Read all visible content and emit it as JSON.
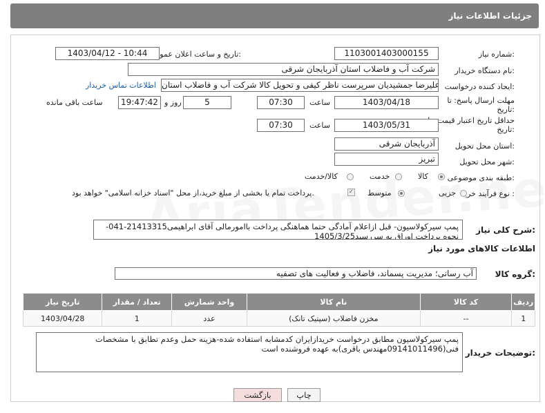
{
  "header": {
    "title": "جزئیات اطلاعات نیاز"
  },
  "fields": {
    "need_number_label": "شماره نیاز:",
    "need_number": "1103001403000155",
    "announce_label": "تاریخ و ساعت اعلان عمومی:",
    "announce_value": "1403/04/12 - 10:44",
    "buyer_org_label": "نام دستگاه خریدار:",
    "buyer_org": "شرکت آب و فاضلاب استان آذربایجان شرقی",
    "requester_label": "ایجاد کننده درخواست:",
    "requester": "علیرضا جمشیدیان سرپرست ناظر کیفی و تحویل کالا شرکت آب و فاضلاب استان",
    "buyer_contact_link": "اطلاعات تماس خریدار",
    "deadline_label_1": "مهلت ارسال پاسخ: تا",
    "deadline_label_2": "تاریخ:",
    "deadline_date": "1403/04/18",
    "time_label": "ساعت",
    "deadline_time": "07:30",
    "days_value": "5",
    "days_label": "روز و",
    "remaining_time": "19:47:42",
    "remaining_label": "ساعت باقی مانده",
    "min_validity_label_1": "حداقل تاریخ اعتبار قیمت: تا",
    "min_validity_label_2": "تاریخ:",
    "validity_date": "1403/05/31",
    "validity_time": "07:30",
    "province_label": "استان محل تحویل:",
    "province": "آذربایجان شرقی",
    "city_label": "شهر محل تحویل:",
    "city": "تبریز",
    "category_label": "طبقه بندی موضوعی:",
    "category_options": [
      "کالا",
      "خدمت",
      "کالا/خدمت"
    ],
    "process_label": "نوع فرآیند خرید :",
    "process_options": [
      "جزیی",
      "متوسط"
    ],
    "payment_note": "پرداخت تمام یا بخشی از مبلغ خرید،از محل \"اسناد خزانه اسلامی\" خواهد بود."
  },
  "description": {
    "label": "شرح کلی نیاز:",
    "text": "پمپ سیرکولاسیون- قبل ازاعلام آمادگی حتما هماهنگی پرداخت باامورمالی آقای ابراهیمی21413315-041-نحوه پرداخت اوراق به سررسید1405/3/25"
  },
  "goods_section": {
    "title": "اطلاعات کالاهای مورد نیاز",
    "group_label": "گروه کالا:",
    "group_value": "آب رسانی؛ مدیریت پسماند، فاضلاب و فعالیت های تصفیه",
    "table": {
      "headers": [
        "ردیف",
        "کد کالا",
        "نام کالا",
        "واحد شمارش",
        "تعداد / مقدار",
        "تاریخ نیاز"
      ],
      "rows": [
        [
          "1",
          "--",
          "مخزن فاضلاب (سپتیک تانک)",
          "عدد",
          "1",
          "1403/04/28"
        ]
      ]
    }
  },
  "buyer_notes": {
    "label": "توضیحات خریدار:",
    "text": "پمپ سیرکولاسیون مطابق درخواست خریدازایران کدمشابه استفاده شده-هزینه حمل وعدم تطابق با مشخصات فنی(09141011496مهندس باقری)به عهده فروشنده است"
  },
  "buttons": {
    "print": "چاپ",
    "back": "بازگشت"
  },
  "watermark": "AriaTender.net",
  "colors": {
    "header_bg": "#7f7f7f",
    "table_header_bg": "#8c8c8c",
    "link": "#1a5ea8",
    "back_button_bg": "#f7dede"
  }
}
